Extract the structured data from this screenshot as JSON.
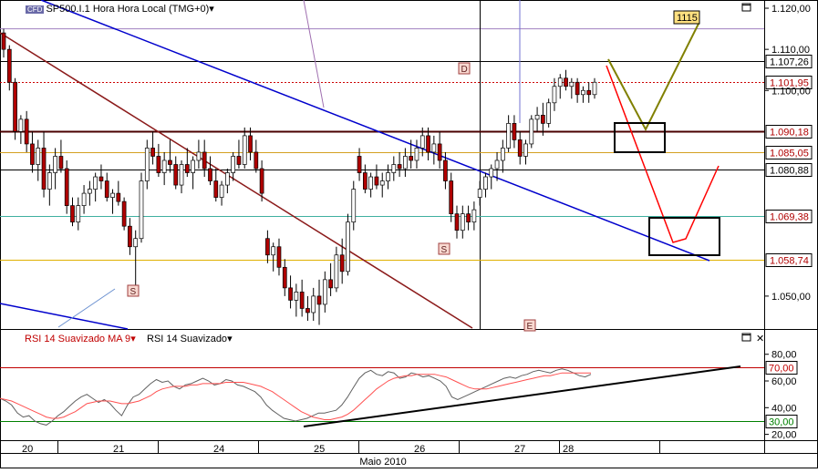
{
  "main_header": {
    "logo": "CFD",
    "title": "SP500.I.1 Hora Hora Local (TMG+0)"
  },
  "rsi_header": {
    "indicator_1": "RSI 14 Suavizado MA 9",
    "indicator_2": "RSI 14 Suavizado"
  },
  "colors": {
    "up_candle": "#ffffff",
    "down_candle": "#b00000",
    "rsi_line": "#606060",
    "rsi_ma": "#ff5050",
    "blue_trend": "#0000cc",
    "brown_trend": "#8b1a1a",
    "olive": "#808000",
    "red_projection": "#ff0000"
  },
  "chart_data": [
    {
      "type": "candlestick",
      "title": "SP500.I.1 Hora Hora Local (TMG+0)",
      "yticks": [
        "1.120,00",
        "1.110,00",
        "1.100,00",
        "1.050,00"
      ],
      "ytick_values": [
        1120,
        1110,
        1100,
        1050
      ],
      "ylim": [
        1042,
        1122
      ],
      "xlabel": "Maio 2010",
      "day_labels": [
        "20",
        "21",
        "24",
        "25",
        "26",
        "27",
        "28"
      ],
      "price_levels": [
        {
          "label": "1.107,26",
          "value": 1107.26,
          "color": "#000000",
          "style": "solid"
        },
        {
          "label": "1.101,95",
          "value": 1101.95,
          "color": "#cc0000",
          "style": "dotted"
        },
        {
          "label": "1.090,18",
          "value": 1090.18,
          "color": "#4a0000",
          "style": "solid"
        },
        {
          "label": "1.085,05",
          "value": 1085.05,
          "color": "#d4a020",
          "style": "solid"
        },
        {
          "label": "1.080,88",
          "value": 1080.88,
          "color": "#000000",
          "style": "solid"
        },
        {
          "label": "1.069,38",
          "value": 1069.38,
          "color": "#40b0a0",
          "style": "solid"
        },
        {
          "label": "1.058,74",
          "value": 1058.74,
          "color": "#e0b000",
          "style": "solid"
        }
      ],
      "extra_level": {
        "value": 1115,
        "color": "#a080c0"
      },
      "annotations": [
        {
          "label": "1115",
          "kind": "target"
        },
        {
          "label": "D",
          "kind": "marker"
        },
        {
          "label": "S",
          "kind": "marker"
        },
        {
          "label": "S",
          "kind": "marker"
        },
        {
          "label": "E",
          "kind": "marker"
        }
      ],
      "candles": [
        [
          1114,
          1115,
          1108,
          1110
        ],
        [
          1110,
          1111,
          1100,
          1102
        ],
        [
          1102,
          1103,
          1088,
          1090
        ],
        [
          1090,
          1094,
          1087,
          1093
        ],
        [
          1093,
          1095,
          1085,
          1087
        ],
        [
          1087,
          1090,
          1080,
          1082
        ],
        [
          1082,
          1088,
          1078,
          1086
        ],
        [
          1086,
          1090,
          1074,
          1076
        ],
        [
          1076,
          1082,
          1072,
          1080
        ],
        [
          1080,
          1086,
          1076,
          1084
        ],
        [
          1084,
          1088,
          1080,
          1081
        ],
        [
          1081,
          1083,
          1070,
          1072
        ],
        [
          1072,
          1074,
          1067,
          1068
        ],
        [
          1068,
          1074,
          1066,
          1072
        ],
        [
          1072,
          1077,
          1070,
          1075
        ],
        [
          1075,
          1078,
          1072,
          1076
        ],
        [
          1076,
          1080,
          1073,
          1079
        ],
        [
          1079,
          1082,
          1076,
          1078
        ],
        [
          1078,
          1080,
          1073,
          1074
        ],
        [
          1074,
          1076,
          1070,
          1075
        ],
        [
          1075,
          1078,
          1072,
          1073
        ],
        [
          1073,
          1074,
          1066,
          1067
        ],
        [
          1067,
          1069,
          1060,
          1062
        ],
        [
          1062,
          1066,
          1052,
          1064
        ],
        [
          1064,
          1080,
          1063,
          1078
        ],
        [
          1078,
          1088,
          1076,
          1086
        ],
        [
          1086,
          1090,
          1082,
          1084
        ],
        [
          1084,
          1087,
          1079,
          1080
        ],
        [
          1080,
          1085,
          1077,
          1083
        ],
        [
          1083,
          1088,
          1080,
          1082
        ],
        [
          1082,
          1084,
          1076,
          1077
        ],
        [
          1077,
          1083,
          1075,
          1082
        ],
        [
          1082,
          1086,
          1079,
          1080
        ],
        [
          1080,
          1084,
          1076,
          1083
        ],
        [
          1083,
          1088,
          1081,
          1085
        ],
        [
          1085,
          1088,
          1079,
          1081
        ],
        [
          1081,
          1084,
          1077,
          1078
        ],
        [
          1078,
          1081,
          1073,
          1074
        ],
        [
          1074,
          1078,
          1072,
          1077
        ],
        [
          1077,
          1081,
          1075,
          1080
        ],
        [
          1080,
          1085,
          1078,
          1084
        ],
        [
          1084,
          1088,
          1081,
          1082
        ],
        [
          1082,
          1091,
          1081,
          1089
        ],
        [
          1089,
          1091,
          1083,
          1085
        ],
        [
          1085,
          1088,
          1080,
          1081
        ],
        [
          1081,
          1083,
          1073,
          1075
        ],
        [
          1064,
          1066,
          1058,
          1060
        ],
        [
          1060,
          1063,
          1056,
          1062
        ],
        [
          1062,
          1064,
          1055,
          1057
        ],
        [
          1057,
          1059,
          1050,
          1052
        ],
        [
          1052,
          1055,
          1047,
          1049
        ],
        [
          1049,
          1053,
          1045,
          1051
        ],
        [
          1051,
          1054,
          1045,
          1047
        ],
        [
          1047,
          1050,
          1044,
          1046
        ],
        [
          1046,
          1052,
          1044,
          1050
        ],
        [
          1050,
          1054,
          1043,
          1048
        ],
        [
          1048,
          1056,
          1046,
          1054
        ],
        [
          1054,
          1058,
          1050,
          1052
        ],
        [
          1052,
          1062,
          1051,
          1060
        ],
        [
          1060,
          1064,
          1053,
          1056
        ],
        [
          1056,
          1070,
          1055,
          1068
        ],
        [
          1068,
          1078,
          1066,
          1076
        ],
        [
          1084,
          1086,
          1078,
          1080
        ],
        [
          1080,
          1082,
          1075,
          1076
        ],
        [
          1076,
          1080,
          1074,
          1079
        ],
        [
          1079,
          1082,
          1076,
          1077
        ],
        [
          1077,
          1080,
          1074,
          1078
        ],
        [
          1078,
          1082,
          1076,
          1080
        ],
        [
          1080,
          1084,
          1078,
          1082
        ],
        [
          1082,
          1085,
          1079,
          1081
        ],
        [
          1081,
          1086,
          1079,
          1084
        ],
        [
          1084,
          1088,
          1081,
          1083
        ],
        [
          1083,
          1088,
          1081,
          1086
        ],
        [
          1086,
          1091,
          1084,
          1089
        ],
        [
          1089,
          1091,
          1083,
          1085
        ],
        [
          1085,
          1089,
          1082,
          1087
        ],
        [
          1087,
          1090,
          1081,
          1083
        ],
        [
          1083,
          1085,
          1076,
          1078
        ],
        [
          1078,
          1080,
          1068,
          1070
        ],
        [
          1070,
          1072,
          1064,
          1066
        ],
        [
          1066,
          1072,
          1064,
          1070
        ],
        [
          1070,
          1072,
          1066,
          1068
        ],
        [
          1068,
          1073,
          1066,
          1071
        ],
        [
          1074,
          1078,
          1072,
          1076
        ],
        [
          1076,
          1080,
          1074,
          1079
        ],
        [
          1079,
          1082,
          1076,
          1081
        ],
        [
          1081,
          1085,
          1078,
          1083
        ],
        [
          1083,
          1088,
          1080,
          1086
        ],
        [
          1086,
          1094,
          1085,
          1092
        ],
        [
          1092,
          1094,
          1086,
          1088
        ],
        [
          1088,
          1090,
          1082,
          1084
        ],
        [
          1084,
          1088,
          1082,
          1087
        ],
        [
          1087,
          1094,
          1086,
          1093
        ],
        [
          1093,
          1096,
          1090,
          1094
        ],
        [
          1094,
          1097,
          1089,
          1092
        ],
        [
          1092,
          1098,
          1091,
          1097
        ],
        [
          1097,
          1103,
          1095,
          1101
        ],
        [
          1101,
          1104,
          1098,
          1103
        ],
        [
          1103,
          1105,
          1100,
          1101
        ],
        [
          1101,
          1103,
          1098,
          1102
        ],
        [
          1102,
          1103,
          1097,
          1099
        ],
        [
          1099,
          1101,
          1097,
          1100
        ],
        [
          1100,
          1102,
          1097,
          1099
        ],
        [
          1099,
          1103,
          1098,
          1102
        ]
      ]
    },
    {
      "type": "line",
      "title": "RSI 14 Suavizado MA 9",
      "yticks": [
        "80,00",
        "60,00",
        "40,00",
        "20,00"
      ],
      "ytick_values": [
        80,
        60,
        40,
        20
      ],
      "ylim": [
        17,
        88
      ],
      "levels": [
        {
          "label": "70,00",
          "value": 70,
          "color": "#c00000"
        },
        {
          "label": "30,00",
          "value": 30,
          "color": "#008000"
        }
      ],
      "series": [
        {
          "values": [
            47,
            45,
            42,
            36,
            33,
            34,
            30,
            28,
            27,
            30,
            34,
            37,
            41,
            45,
            48,
            50,
            47,
            44,
            46,
            43,
            38,
            34,
            42,
            48,
            50,
            54,
            58,
            61,
            59,
            60,
            56,
            54,
            57,
            58,
            60,
            62,
            60,
            57,
            58,
            61,
            60,
            57,
            56,
            54,
            52,
            48,
            42,
            38,
            35,
            32,
            31,
            30,
            31,
            32,
            34,
            36,
            36,
            37,
            38,
            42,
            48,
            55,
            62,
            66,
            68,
            65,
            64,
            67,
            66,
            62,
            63,
            66,
            65,
            63,
            64,
            62,
            60,
            56,
            48,
            46,
            48,
            50,
            52,
            54,
            56,
            58,
            60,
            62,
            63,
            62,
            64,
            65,
            67,
            68,
            67,
            66,
            68,
            69,
            68,
            66,
            64,
            63,
            65
          ]
        },
        {
          "values": [
            47,
            46,
            45,
            43,
            41,
            39,
            37,
            35,
            33,
            32,
            32,
            33,
            35,
            37,
            40,
            43,
            44,
            45,
            45,
            45,
            44,
            43,
            43,
            44,
            45,
            47,
            49,
            52,
            54,
            55,
            56,
            56,
            56,
            57,
            57,
            58,
            58,
            58,
            58,
            59,
            59,
            59,
            59,
            58,
            57,
            56,
            54,
            52,
            49,
            46,
            43,
            40,
            37,
            35,
            33,
            32,
            31,
            31,
            32,
            33,
            35,
            38,
            42,
            46,
            50,
            54,
            57,
            60,
            62,
            63,
            64,
            64,
            65,
            65,
            65,
            65,
            64,
            63,
            61,
            59,
            57,
            55,
            54,
            54,
            54,
            55,
            56,
            57,
            58,
            59,
            60,
            61,
            62,
            63,
            64,
            64,
            65,
            66,
            66,
            66,
            66,
            66,
            66
          ]
        }
      ]
    }
  ]
}
